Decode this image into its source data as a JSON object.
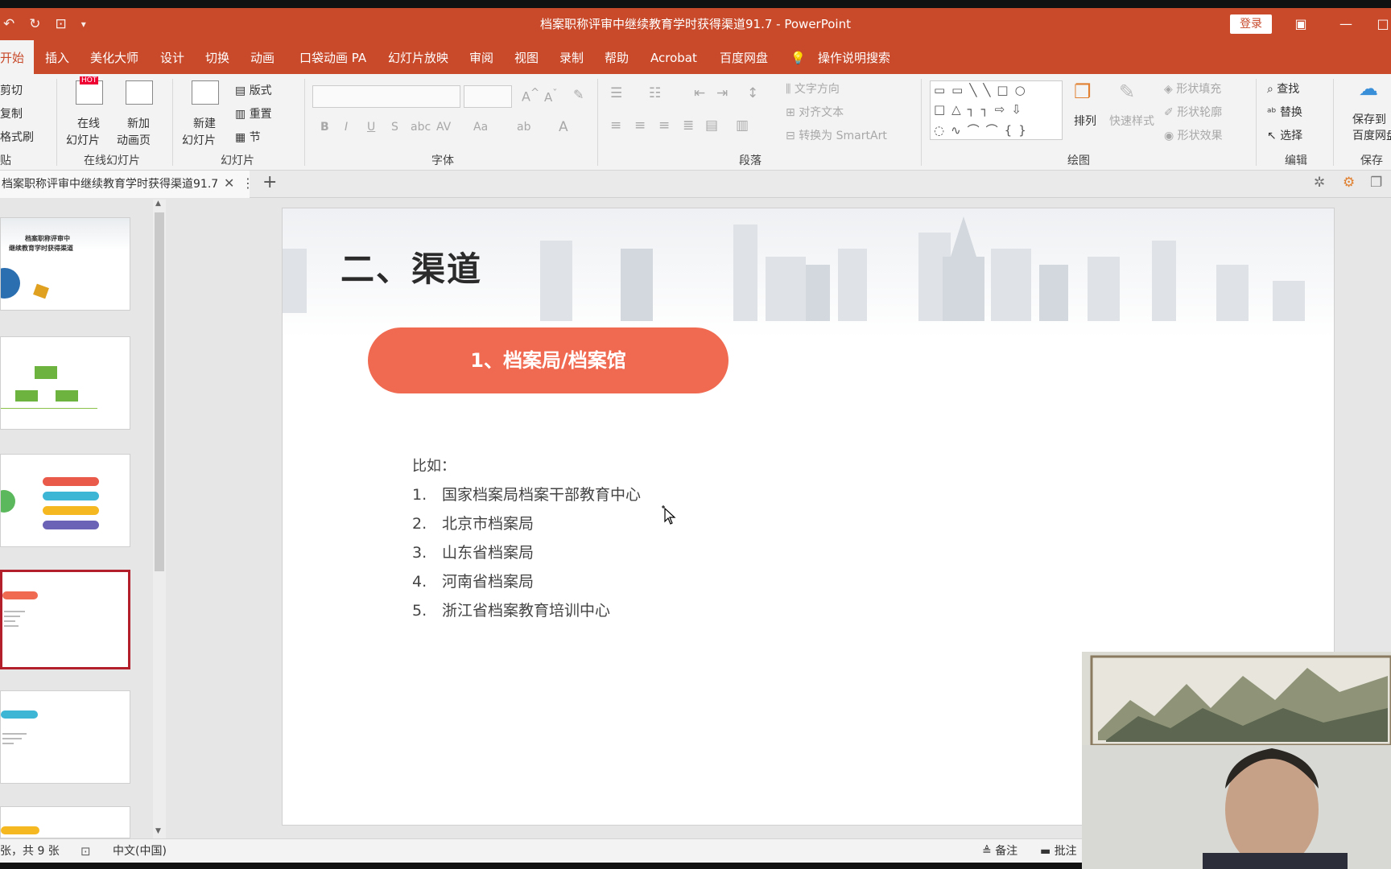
{
  "window": {
    "title": "档案职称评审中继续教育学时获得渠道91.7  -  PowerPoint",
    "login_label": "登录",
    "minimize_label": "—"
  },
  "tabs": {
    "home": "开始",
    "insert": "插入",
    "beautify": "美化大师",
    "design": "设计",
    "transitions": "切换",
    "animations": "动画",
    "pocket_animation": "口袋动画 PA",
    "slideshow": "幻灯片放映",
    "review": "审阅",
    "view": "视图",
    "record": "录制",
    "help": "帮助",
    "acrobat": "Acrobat",
    "baidu_disk": "百度网盘",
    "tell_me": "操作说明搜索"
  },
  "ribbon": {
    "clipboard": {
      "cut": "剪切",
      "copy": "复制",
      "format_painter": "格式刷",
      "label": "贴"
    },
    "online_slides": {
      "online_slides_label": "在线",
      "online_slides_label2": "幻灯片",
      "add_anim_label": "新加",
      "add_anim_label2": "动画页",
      "group": "在线幻灯片",
      "hot": "HOT"
    },
    "slides": {
      "new_slide": "新建",
      "new_slide2": "幻灯片",
      "layout": "版式",
      "reset": "重置",
      "section": "节",
      "group": "幻灯片"
    },
    "font": {
      "group": "字体",
      "bold": "B",
      "italic": "I",
      "underline": "U",
      "strike": "S",
      "abc": "abc",
      "av": "AV",
      "aa": "Aa",
      "font_color": "A"
    },
    "paragraph": {
      "group": "段落",
      "text_direction": "文字方向",
      "align_text": "对齐文本",
      "smartart": "转换为 SmartArt"
    },
    "drawing": {
      "group": "绘图",
      "arrange": "排列",
      "quick_styles": "快速样式",
      "shape_fill": "形状填充",
      "shape_outline": "形状轮廓",
      "shape_effects": "形状效果"
    },
    "editing": {
      "group": "编辑",
      "find": "查找",
      "replace": "替换",
      "select": "选择"
    },
    "save": {
      "group": "保存",
      "label1": "保存到",
      "label2": "百度网盘"
    }
  },
  "document_tab": {
    "name": "档案职称评审中继续教育学时获得渠道91.7"
  },
  "thumbnails": {
    "t1_line1": "档案职称评审中",
    "t1_line2": "继续教育学时获得渠道"
  },
  "slide": {
    "title": "二、渠道",
    "pill_text": "1、档案局/档案馆",
    "example_label": "比如：",
    "items": [
      {
        "num": "1.",
        "text": "国家档案局档案干部教育中心"
      },
      {
        "num": "2.",
        "text": "北京市档案局"
      },
      {
        "num": "3.",
        "text": "山东省档案局"
      },
      {
        "num": "4.",
        "text": "河南省档案局"
      },
      {
        "num": "5.",
        "text": "浙江省档案教育培训中心"
      }
    ]
  },
  "statusbar": {
    "slide_count": "张，共 9 张",
    "language": "中文(中国)",
    "notes": "备注",
    "comments": "批注"
  },
  "colors": {
    "accent": "#c84a2b",
    "pill": "#f06a51",
    "selected_thumb": "#b3202c"
  }
}
